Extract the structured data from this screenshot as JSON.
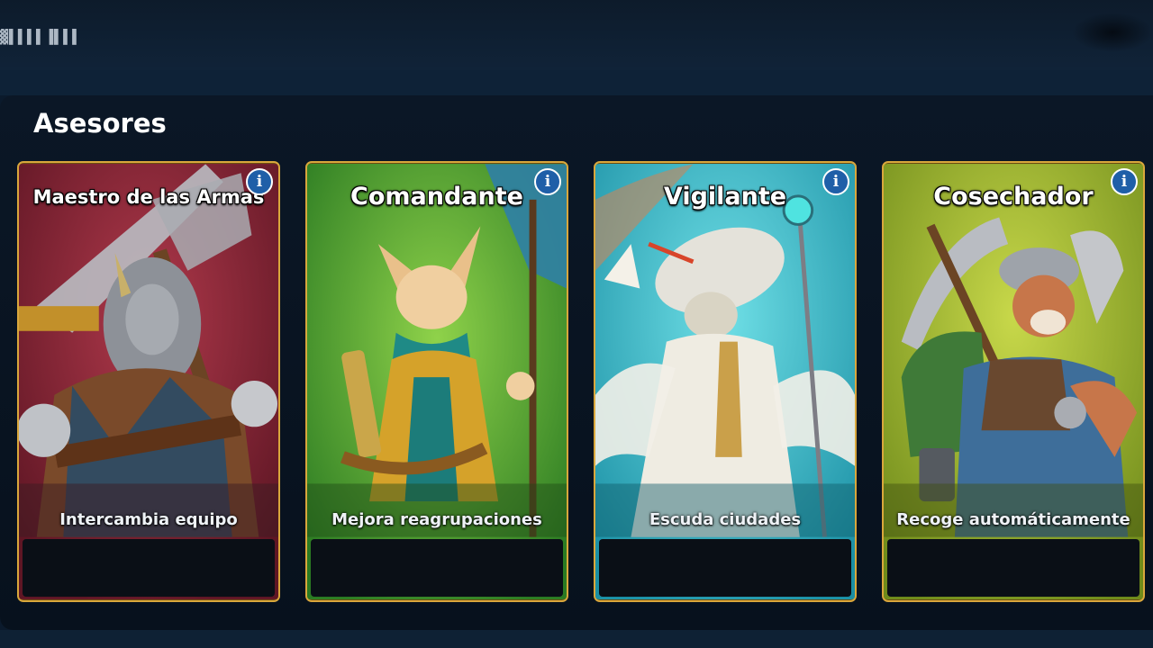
{
  "header": {
    "status_text": "▓▌▌▌▌▐▌▌▌"
  },
  "section": {
    "title": "Asesores"
  },
  "advisors": [
    {
      "name": "Maestro de las Armas",
      "description": "Intercambia equipo",
      "color": "#8a2436",
      "info_label": "i",
      "icon": "info-icon"
    },
    {
      "name": "Comandante",
      "description": "Mejora reagrupaciones",
      "color": "#3e9a2c",
      "info_label": "i",
      "icon": "info-icon"
    },
    {
      "name": "Vigilante",
      "description": "Escuda ciudades",
      "color": "#2bb3c6",
      "info_label": "i",
      "icon": "info-icon"
    },
    {
      "name": "Cosechador",
      "description": "Recoge automáticamente",
      "color": "#8aa424",
      "info_label": "i",
      "icon": "info-icon"
    }
  ],
  "colors": {
    "card_border": "#d9a73c",
    "info_badge": "#1f5fa8",
    "background": "#0b1a2c"
  }
}
